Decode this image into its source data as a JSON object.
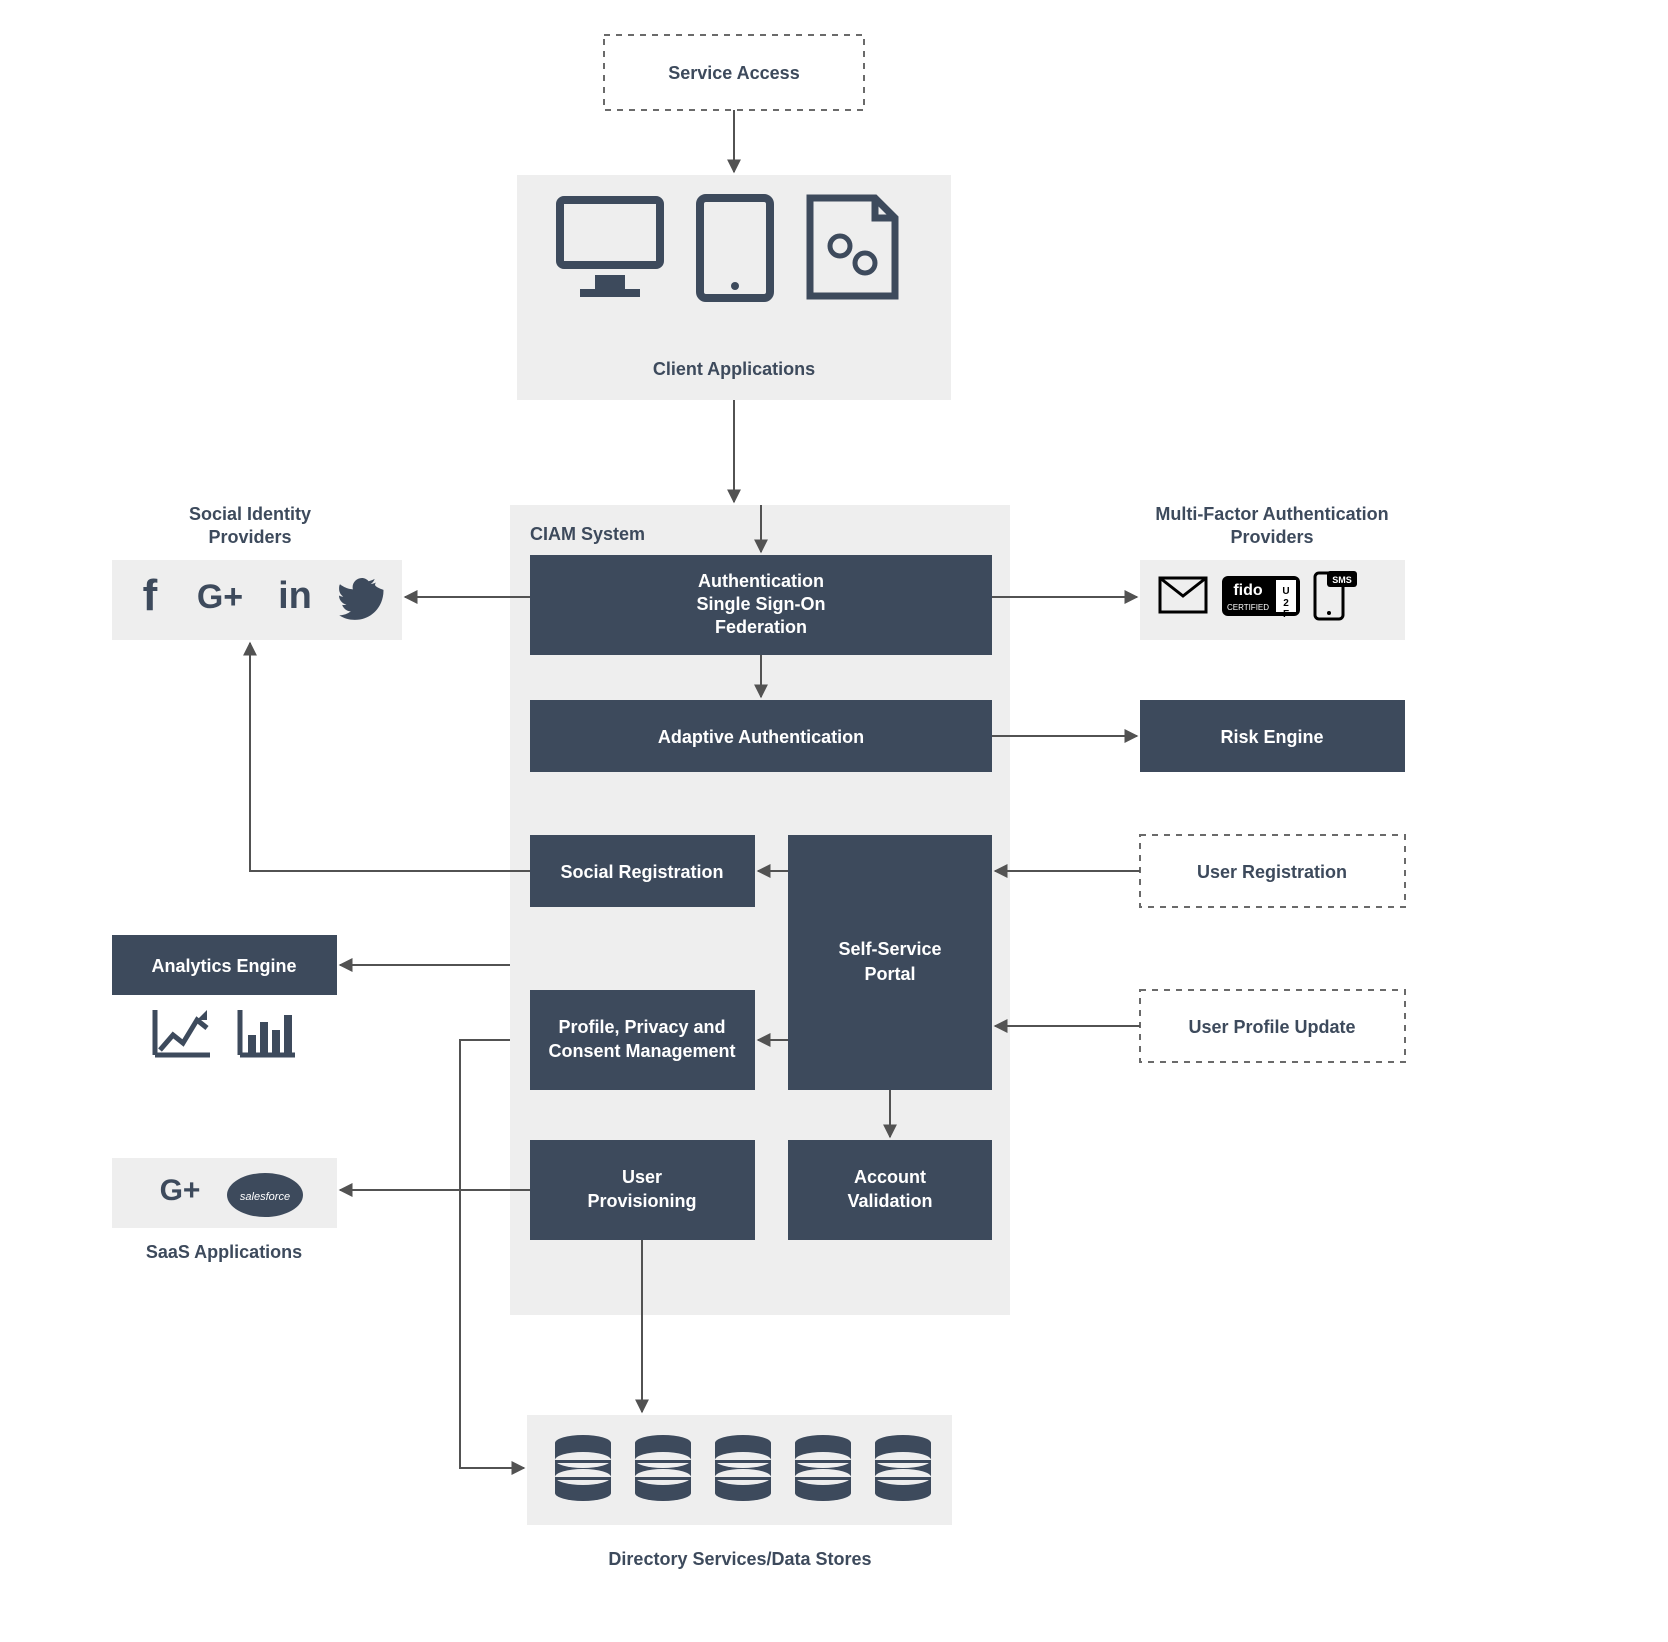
{
  "service_access": {
    "label": "Service Access"
  },
  "client_apps": {
    "label": "Client Applications",
    "icons": [
      "desktop-icon",
      "tablet-icon",
      "document-gears-icon"
    ]
  },
  "ciam": {
    "title": "CIAM System"
  },
  "auth_box": {
    "line1": "Authentication",
    "line2": "Single Sign-On",
    "line3": "Federation"
  },
  "adaptive": {
    "label": "Adaptive Authentication"
  },
  "risk": {
    "label": "Risk Engine"
  },
  "social_reg": {
    "label": "Social Registration"
  },
  "self_service": {
    "line1": "Self-Service",
    "line2": "Portal"
  },
  "profile": {
    "line1": "Profile, Privacy and",
    "line2": "Consent Management"
  },
  "user_prov": {
    "line1": "User",
    "line2": "Provisioning"
  },
  "account_val": {
    "line1": "Account",
    "line2": "Validation"
  },
  "social_idp": {
    "line1": "Social Identity",
    "line2": "Providers",
    "icons": [
      "facebook-icon",
      "google-plus-icon",
      "linkedin-icon",
      "twitter-icon"
    ]
  },
  "mfa": {
    "line1": "Multi-Factor Authentication",
    "line2": "Providers",
    "icons": [
      "envelope-icon",
      "fido-u2f-icon",
      "sms-phone-icon"
    ]
  },
  "user_reg": {
    "label": "User Registration"
  },
  "user_profile": {
    "label": "User Profile Update"
  },
  "analytics": {
    "label": "Analytics Engine",
    "icons": [
      "line-chart-icon",
      "bar-chart-icon"
    ]
  },
  "saas": {
    "label": "SaaS Applications",
    "icons": [
      "google-plus-icon",
      "salesforce-icon"
    ]
  },
  "directory": {
    "label": "Directory Services/Data Stores",
    "icons": [
      "database-icon",
      "database-icon",
      "database-icon",
      "database-icon",
      "database-icon"
    ]
  }
}
